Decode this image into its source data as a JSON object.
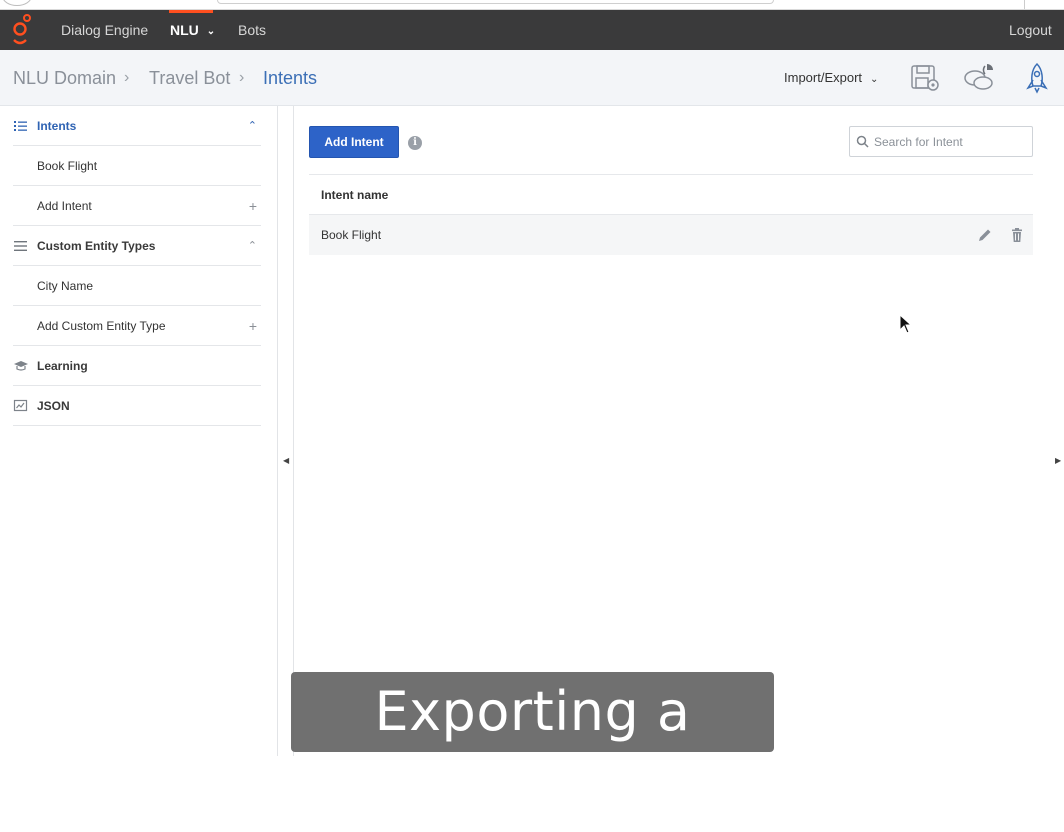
{
  "nav": {
    "items": [
      {
        "label": "Dialog Engine"
      },
      {
        "label": "NLU"
      },
      {
        "label": "Bots"
      }
    ],
    "logout_label": "Logout"
  },
  "breadcrumb": {
    "items": [
      "NLU Domain",
      "Travel Bot",
      "Intents"
    ]
  },
  "toolbar": {
    "import_export_label": "Import/Export"
  },
  "sidebar": {
    "sections": [
      {
        "label": "Intents",
        "icon": "list-icon",
        "expanded": true
      },
      {
        "label": "Book Flight"
      },
      {
        "label": "Add Intent"
      },
      {
        "label": "Custom Entity Types",
        "icon": "menu-icon",
        "expanded": true
      },
      {
        "label": "City Name"
      },
      {
        "label": "Add Custom Entity Type"
      },
      {
        "label": "Learning",
        "icon": "graduation-cap-icon"
      },
      {
        "label": "JSON",
        "icon": "json-icon"
      }
    ]
  },
  "main": {
    "add_intent_label": "Add Intent",
    "search_placeholder": "Search for Intent",
    "table": {
      "columns": [
        "Intent name"
      ],
      "rows": [
        {
          "name": "Book Flight"
        }
      ]
    }
  },
  "caption": {
    "text": "Exporting a domain"
  },
  "colors": {
    "nav_bg": "#3a3a3b",
    "accent_orange": "#ff4f1f",
    "primary_blue": "#2d63c8",
    "link_blue": "#3b6fb6"
  }
}
